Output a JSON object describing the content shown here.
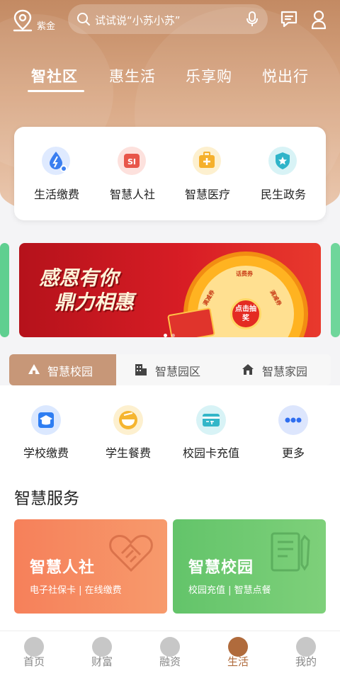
{
  "topbar": {
    "location": "紫金",
    "search_placeholder": "试试说“小苏小苏”"
  },
  "tabs": [
    {
      "label": "智社区",
      "active": true
    },
    {
      "label": "惠生活",
      "active": false
    },
    {
      "label": "乐享购",
      "active": false
    },
    {
      "label": "悦出行",
      "active": false
    }
  ],
  "quick_services": [
    {
      "label": "生活缴费",
      "icon": "water-drop-icon",
      "color": "#3a7ef0"
    },
    {
      "label": "智慧人社",
      "icon": "social-security-icon",
      "color": "#e8564a"
    },
    {
      "label": "智慧医疗",
      "icon": "medical-kit-icon",
      "color": "#f5b02c"
    },
    {
      "label": "民生政务",
      "icon": "shield-star-icon",
      "color": "#2fb4c9"
    }
  ],
  "banner": {
    "title_line1": "感恩有你",
    "title_line2": "鼎力相惠",
    "wheel_top": "话费券",
    "wheel_left": "满减券",
    "wheel_right": "满减券",
    "wheel_button": "点击抽奖"
  },
  "segment_tabs": [
    {
      "label": "智慧校园",
      "icon": "campus-icon",
      "active": true
    },
    {
      "label": "智慧园区",
      "icon": "building-icon",
      "active": false
    },
    {
      "label": "智慧家园",
      "icon": "home-icon",
      "active": false
    }
  ],
  "campus_services": [
    {
      "label": "学校缴费",
      "icon": "graduation-cap-icon",
      "color": "#2f7ef2"
    },
    {
      "label": "学生餐费",
      "icon": "meal-bowl-icon",
      "color": "#f5b530"
    },
    {
      "label": "校园卡充值",
      "icon": "card-icon",
      "color": "#33b6c8"
    },
    {
      "label": "更多",
      "icon": "more-dots-icon",
      "color": "#4b7cf0"
    }
  ],
  "smart_services": {
    "title": "智慧服务",
    "cards": [
      {
        "title": "智慧人社",
        "subtitle": "电子社保卡 | 在线缴费",
        "color": "#f5835a"
      },
      {
        "title": "智慧校园",
        "subtitle": "校园充值 | 智慧点餐",
        "color": "#69c96d"
      }
    ]
  },
  "bottom_nav": [
    {
      "label": "首页",
      "icon": "home-nav-icon",
      "active": false
    },
    {
      "label": "财富",
      "icon": "wealth-icon",
      "active": false
    },
    {
      "label": "融资",
      "icon": "finance-icon",
      "active": false
    },
    {
      "label": "生活",
      "icon": "coffee-cup-icon",
      "active": true
    },
    {
      "label": "我的",
      "icon": "user-icon",
      "active": false
    }
  ]
}
